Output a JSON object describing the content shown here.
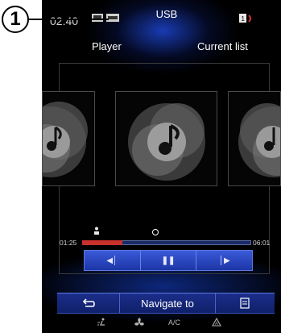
{
  "callout": {
    "number": "1"
  },
  "status_bar": {
    "time": "02:40",
    "source_title": "USB"
  },
  "tabs": {
    "player": "Player",
    "current_list": "Current list"
  },
  "covers": [
    {
      "icon": "music-note-icon"
    },
    {
      "icon": "music-note-icon"
    },
    {
      "icon": "music-note-icon"
    }
  ],
  "progress": {
    "elapsed": "01:25",
    "total": "06:01",
    "fraction": 0.24
  },
  "transport": {
    "previous_icon": "previous-track-icon",
    "pause_icon": "pause-icon",
    "next_icon": "next-track-icon"
  },
  "bottom_bar": {
    "back_icon": "back-arrow-icon",
    "navigate_label": "Navigate to",
    "list_icon": "list-icon"
  },
  "climate": {
    "ac_label": "A/C"
  },
  "colors": {
    "accent_blue": "#2443c2",
    "progress_red": "#c8312c",
    "screen_bg": "#000000"
  }
}
